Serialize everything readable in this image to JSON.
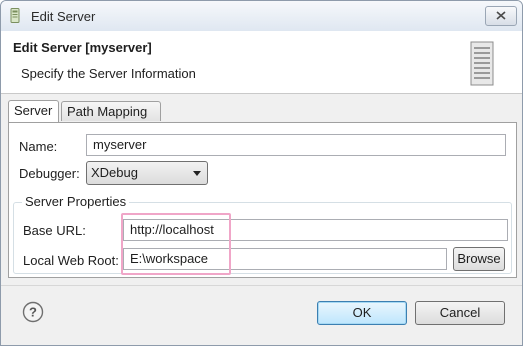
{
  "window": {
    "title": "Edit Server"
  },
  "banner": {
    "title": "Edit Server [myserver]",
    "description": "Specify the Server Information"
  },
  "tabs": [
    {
      "label": "Server",
      "active": true
    },
    {
      "label": "Path Mapping",
      "active": false
    }
  ],
  "form": {
    "name_label": "Name:",
    "name_value": "myserver",
    "debugger_label": "Debugger:",
    "debugger_value": "XDebug",
    "group_title": "Server Properties",
    "base_url_label": "Base URL:",
    "base_url_value": "http://localhost",
    "local_root_label": "Local Web Root:",
    "local_root_value": "E:\\workspace",
    "browse_label": "Browse"
  },
  "footer": {
    "ok_label": "OK",
    "cancel_label": "Cancel"
  },
  "colors": {
    "highlight": "#f0a6c8",
    "default_button": "#bee6fd"
  }
}
